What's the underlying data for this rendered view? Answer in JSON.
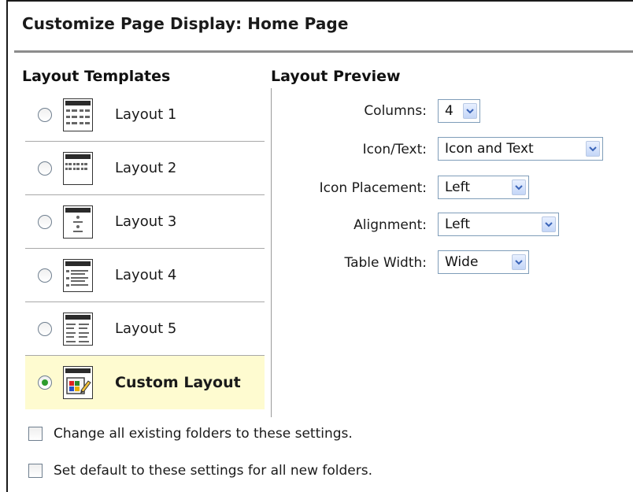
{
  "page": {
    "title": "Customize Page Display: Home Page"
  },
  "templates": {
    "heading": "Layout Templates",
    "items": [
      {
        "label": "Layout 1",
        "icon": "layout-1-icon",
        "selected": false
      },
      {
        "label": "Layout 2",
        "icon": "layout-2-icon",
        "selected": false
      },
      {
        "label": "Layout 3",
        "icon": "layout-3-icon",
        "selected": false
      },
      {
        "label": "Layout 4",
        "icon": "layout-4-icon",
        "selected": false
      },
      {
        "label": "Layout 5",
        "icon": "layout-5-icon",
        "selected": false
      },
      {
        "label": "Custom Layout",
        "icon": "custom-layout-icon",
        "selected": true
      }
    ]
  },
  "preview": {
    "heading": "Layout Preview",
    "fields": [
      {
        "label": "Columns:",
        "value": "4"
      },
      {
        "label": "Icon/Text:",
        "value": "Icon and Text"
      },
      {
        "label": "Icon Placement:",
        "value": "Left"
      },
      {
        "label": "Alignment:",
        "value": "Left"
      },
      {
        "label": "Table Width:",
        "value": "Wide"
      }
    ]
  },
  "options": [
    {
      "label": "Change all existing folders to these settings.",
      "checked": false
    },
    {
      "label": "Set default to these settings for all new folders.",
      "checked": false
    }
  ],
  "colors": {
    "selected_row": "#fefbd0",
    "radio_dot": "#2c9c2c",
    "select_border": "#7f9db9",
    "arrow_blue": "#3a64b8"
  }
}
